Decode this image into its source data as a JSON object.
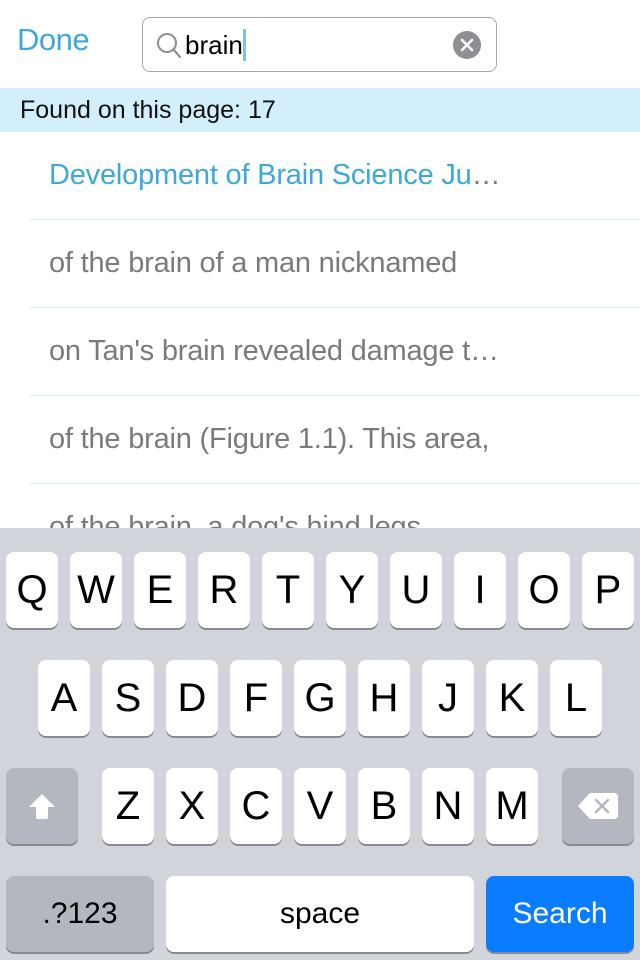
{
  "header": {
    "done_label": "Done",
    "search": {
      "value": "brain",
      "icon": "search-icon",
      "clear_icon": "clear-icon"
    }
  },
  "banner": {
    "text": "Found on this page: 17"
  },
  "results": [
    {
      "text": "Development of Brain Science Ju",
      "truncated": true,
      "is_title": true
    },
    {
      "text": "of the brain of a man nicknamed",
      "truncated": false,
      "is_title": false
    },
    {
      "text": "on Tan's brain revealed damage t",
      "truncated": true,
      "is_title": false
    },
    {
      "text": "of the brain (Figure 1.1). This area,",
      "truncated": false,
      "is_title": false
    },
    {
      "text": "of the brain, a dog's hind legs",
      "truncated": false,
      "is_title": false
    }
  ],
  "ellipsis": "…",
  "keyboard": {
    "row1": [
      "Q",
      "W",
      "E",
      "R",
      "T",
      "Y",
      "U",
      "I",
      "O",
      "P"
    ],
    "row2": [
      "A",
      "S",
      "D",
      "F",
      "G",
      "H",
      "J",
      "K",
      "L"
    ],
    "row3": [
      "Z",
      "X",
      "C",
      "V",
      "B",
      "N",
      "M"
    ],
    "shift_icon": "shift-icon",
    "delete_icon": "delete-icon",
    "numbers_label": ".?123",
    "space_label": "space",
    "search_label": "Search"
  },
  "colors": {
    "accent": "#3ea8d8",
    "banner_bg": "#d3effb",
    "keyboard_bg": "#d1d5db",
    "search_key": "#0a7cff"
  }
}
